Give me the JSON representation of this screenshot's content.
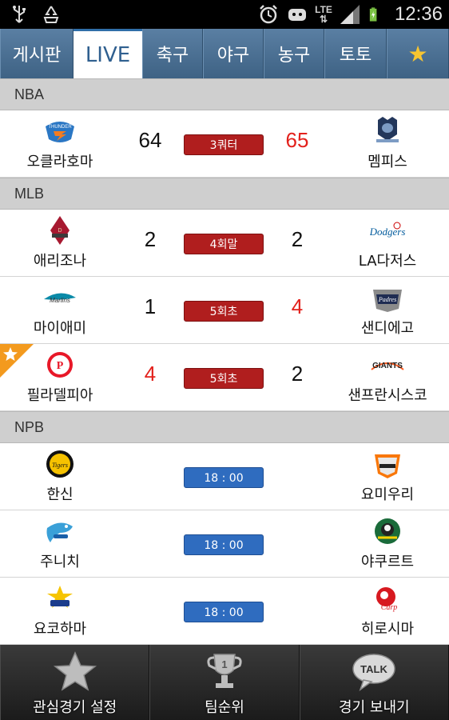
{
  "status_bar": {
    "network": "LTE",
    "time": "12:36"
  },
  "tabs": [
    {
      "label": "게시판",
      "active": false
    },
    {
      "label": "LIVE",
      "active": true
    },
    {
      "label": "축구",
      "active": false
    },
    {
      "label": "야구",
      "active": false
    },
    {
      "label": "농구",
      "active": false
    },
    {
      "label": "토토",
      "active": false
    },
    {
      "label": "★",
      "active": false
    }
  ],
  "leagues": [
    {
      "name": "NBA",
      "games": [
        {
          "home": "오클라호마",
          "away": "멤피스",
          "home_score": "64",
          "away_score": "65",
          "status": "3쿼터",
          "state": "live"
        }
      ]
    },
    {
      "name": "MLB",
      "games": [
        {
          "home": "애리조나",
          "away": "LA다저스",
          "home_score": "2",
          "away_score": "2",
          "status": "4회말",
          "state": "live"
        },
        {
          "home": "마이애미",
          "away": "샌디에고",
          "home_score": "1",
          "away_score": "4",
          "status": "5회초",
          "state": "live"
        },
        {
          "home": "필라델피아",
          "away": "샌프란시스코",
          "home_score": "4",
          "away_score": "2",
          "status": "5회초",
          "state": "live",
          "favorite": true
        }
      ]
    },
    {
      "name": "NPB",
      "games": [
        {
          "home": "한신",
          "away": "요미우리",
          "status": "18 : 00",
          "state": "scheduled"
        },
        {
          "home": "주니치",
          "away": "야쿠르트",
          "status": "18 : 00",
          "state": "scheduled"
        },
        {
          "home": "요코하마",
          "away": "히로시마",
          "status": "18 : 00",
          "state": "scheduled"
        }
      ]
    }
  ],
  "bottom_bar": {
    "favorites_label": "관심경기 설정",
    "ranking_label": "팀순위",
    "share_label": "경기 보내기"
  },
  "colors": {
    "tab_bar": "#4a6f93",
    "live_status": "#b01e1e",
    "scheduled_status": "#2f6cbf",
    "winning_score": "#e3211c",
    "league_header": "#cfcfcf"
  }
}
